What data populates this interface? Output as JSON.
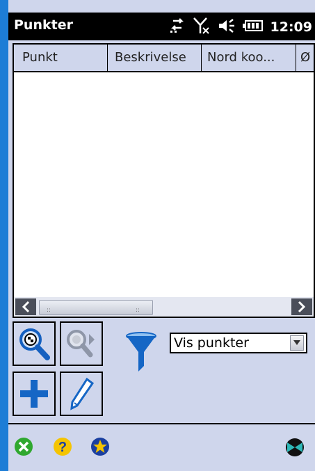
{
  "titlebar": {
    "title": "Punkter",
    "time": "12:09",
    "icons": [
      "connectivity-icon",
      "no-signal-icon",
      "volume-icon",
      "battery-icon"
    ]
  },
  "grid": {
    "columns": [
      "Punkt",
      "Beskrivelse",
      "Nord koo...",
      "Ø"
    ],
    "rows": []
  },
  "toolbar": {
    "zoom_in_icon": "zoom-locate-icon",
    "zoom_next_icon": "zoom-next-icon",
    "add_icon": "plus-icon",
    "edit_icon": "pencil-icon",
    "filter_icon": "funnel-icon"
  },
  "filter": {
    "selected": "Vis punkter"
  },
  "bottombar": {
    "icons": [
      "close-circle-icon",
      "help-icon",
      "favorite-star-icon",
      "app-logo-icon"
    ]
  },
  "colors": {
    "window_bg": "#cfd6ec",
    "title_bg": "#000000",
    "accent_blue": "#1d7dd6"
  }
}
